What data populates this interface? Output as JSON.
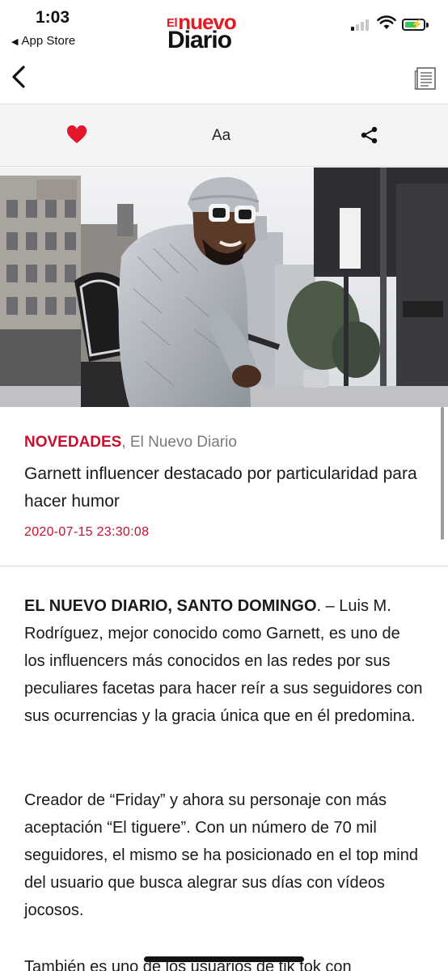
{
  "status_bar": {
    "time": "1:03",
    "back_app_label": "App Store",
    "battery_color": "#34c759"
  },
  "logo": {
    "line1_small": "El",
    "line1": "nuevo",
    "line2": "Diario",
    "brand_color": "#e11b22"
  },
  "navbar": {
    "back_icon": "chevron-left-icon",
    "reader_icon": "document-icon"
  },
  "actions": {
    "favorite_icon": "heart-icon",
    "font_label": "Aa",
    "share_icon": "share-icon",
    "accent_color": "#e2172b"
  },
  "article": {
    "category": "NOVEDADES",
    "source": ", El Nuevo Diario",
    "title": "Garnett influencer destacado por particularidad para hacer humor",
    "date": "2020-07-15 23:30:08",
    "lead_strong": "EL NUEVO DIARIO, SANTO DOMINGO",
    "lead_text": ". – Luis M. Rodríguez, mejor conocido como Garnett, es uno de los influencers más conocidos en las redes por sus peculiares facetas para hacer reír a sus seguidores con sus ocurrencias y la gracia única que en él predomina.",
    "paragraph2": "Creador de “Friday” y ahora su personaje con más aceptación “El tiguere”. Con un número de 70 mil seguidores, el mismo se ha posicionado en el top mind del usuario que busca alegrar sus días con vídeos jocosos.",
    "paragraph3": "También es uno de los usuarios de tik tok con"
  }
}
